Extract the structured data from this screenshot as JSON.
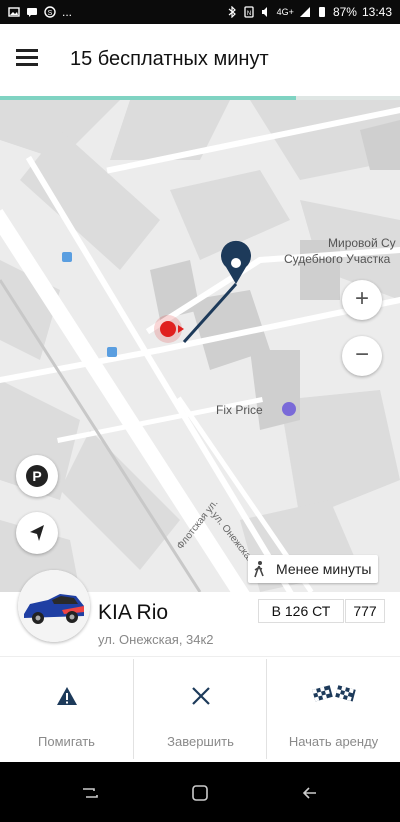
{
  "status_bar": {
    "left_icons": [
      "gallery-icon",
      "message-icon",
      "skype-icon"
    ],
    "left_more": "...",
    "right_icons": [
      "bluetooth-icon",
      "nfc-icon",
      "sound-icon",
      "signal-icon"
    ],
    "network": "4G+",
    "battery": "87%",
    "time": "13:43"
  },
  "toolbar": {
    "menu_icon": "hamburger-icon",
    "title": "15 бесплатных минут",
    "progress": 0.74,
    "progress_color": "#7fd3c2"
  },
  "map": {
    "labels": {
      "court_line1": "Мировой Су",
      "court_line2": "Судебного Участка",
      "fix_price": "Fix Price",
      "street1": "ул. Онежская",
      "street2": "Флотская ул."
    },
    "zoom_in": "+",
    "zoom_out": "−",
    "parking_label": "P",
    "less_minutes": "Менее минуты",
    "pin_color": "#1d3a5a",
    "user_dot_color": "#e0201f"
  },
  "car": {
    "name": "KIA Rio",
    "address": "ул. Онежская, 34к2",
    "plate": "В 126 СТ",
    "region": "777"
  },
  "actions": [
    {
      "label": "Помигать",
      "icon": "warning-icon"
    },
    {
      "label": "Завершить",
      "icon": "close-icon"
    },
    {
      "label": "Начать аренду",
      "icon": "checkered-flags-icon"
    }
  ],
  "navbar": {
    "icons": [
      "recent-apps-icon",
      "home-icon",
      "back-icon"
    ]
  }
}
